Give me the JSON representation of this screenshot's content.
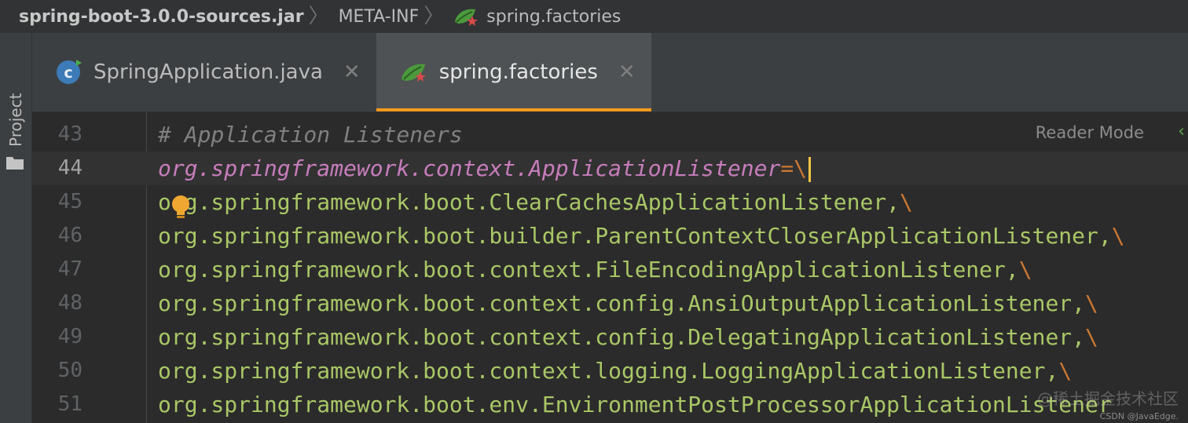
{
  "breadcrumb": {
    "items": [
      "spring-boot-3.0.0-sources.jar",
      "META-INF",
      "spring.factories"
    ]
  },
  "sidebar": {
    "project_label": "Project",
    "folder_icon": "folder-icon"
  },
  "tabs": [
    {
      "label": "SpringApplication.java",
      "icon": "java-class-icon",
      "active": false
    },
    {
      "label": "spring.factories",
      "icon": "spring-leaf-icon",
      "active": true
    }
  ],
  "editor": {
    "reader_mode": "Reader Mode",
    "lines": [
      {
        "num": "43",
        "text": "# Application Listeners"
      },
      {
        "num": "44",
        "key": "org.springframework.context.ApplicationListener",
        "op": "=",
        "esc": "\\"
      },
      {
        "num": "45",
        "val": "org.springframework.boot.ClearCachesApplicationListener,",
        "esc": "\\"
      },
      {
        "num": "46",
        "val": "org.springframework.boot.builder.ParentContextCloserApplicationListener,",
        "esc": "\\"
      },
      {
        "num": "47",
        "val": "org.springframework.boot.context.FileEncodingApplicationListener,",
        "esc": "\\"
      },
      {
        "num": "48",
        "val": "org.springframework.boot.context.config.AnsiOutputApplicationListener,",
        "esc": "\\"
      },
      {
        "num": "49",
        "val": "org.springframework.boot.context.config.DelegatingApplicationListener,",
        "esc": "\\"
      },
      {
        "num": "50",
        "val": "org.springframework.boot.context.logging.LoggingApplicationListener,",
        "esc": "\\"
      },
      {
        "num": "51",
        "val": "org.springframework.boot.env.EnvironmentPostProcessorApplicationListener"
      }
    ]
  },
  "watermark": {
    "line1": "@稀土掘金技术社区",
    "line2": "CSDN @JavaEdge."
  },
  "colors": {
    "accent": "#f49a1c",
    "key": "#c77dbb",
    "value": "#a9c766",
    "comment": "#808080"
  }
}
